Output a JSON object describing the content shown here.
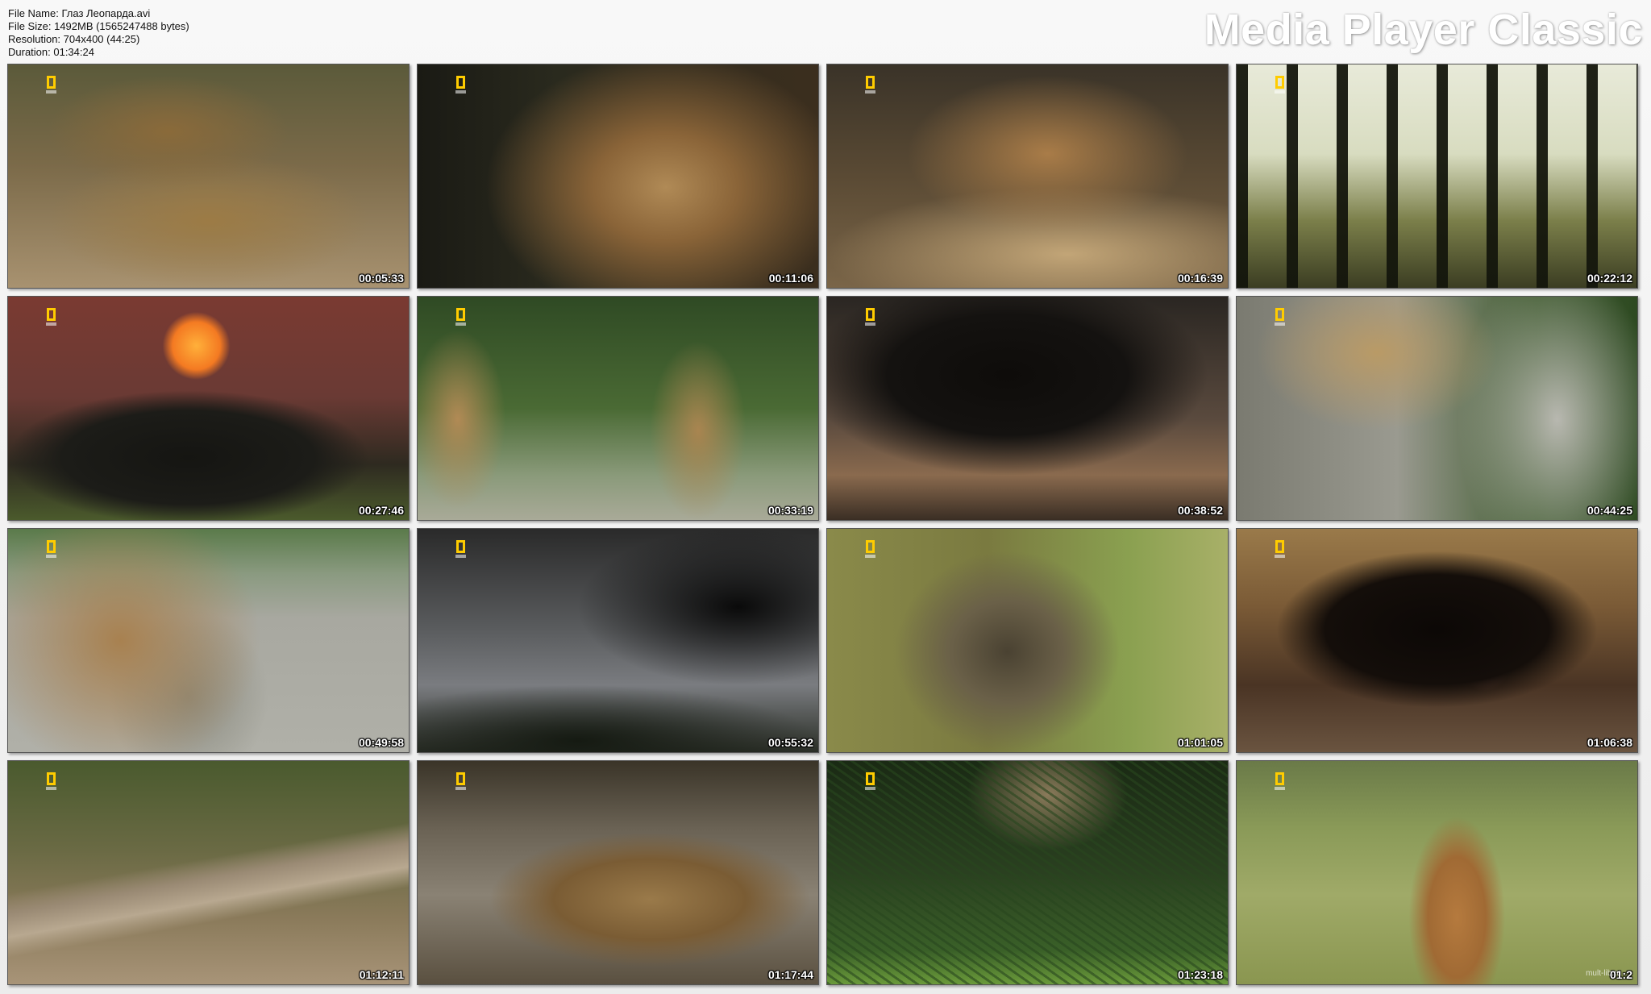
{
  "file_info": {
    "name": "File Name: Глаз Леопарда.avi",
    "size": "File Size: 1492MB (1565247488 bytes)",
    "resolution": "Resolution: 704x400 (44:25)",
    "duration": "Duration: 01:34:24"
  },
  "brand": "Media Player Classic",
  "thumbnails": [
    {
      "time": "00:05:33",
      "scene": "two leopards lying on dry ground"
    },
    {
      "time": "00:11:06",
      "scene": "close-up of leopard face"
    },
    {
      "time": "00:16:39",
      "scene": "leopard yawning on log"
    },
    {
      "time": "00:22:12",
      "scene": "silhouetted forest trees"
    },
    {
      "time": "00:27:46",
      "scene": "buffalo herd at sunset"
    },
    {
      "time": "00:33:19",
      "scene": "two leopards walking in grass"
    },
    {
      "time": "00:38:52",
      "scene": "silhouetted acacia tree"
    },
    {
      "time": "00:44:25",
      "scene": "leopard climbing dead tree"
    },
    {
      "time": "00:49:58",
      "scene": "leopard carrying prey"
    },
    {
      "time": "00:55:32",
      "scene": "tree silhouette under storm clouds"
    },
    {
      "time": "01:01:05",
      "scene": "baboon in grass"
    },
    {
      "time": "01:06:38",
      "scene": "leopard and baby baboon in log"
    },
    {
      "time": "01:12:11",
      "scene": "leopard behind fallen log"
    },
    {
      "time": "01:17:44",
      "scene": "leopard crouching on ground"
    },
    {
      "time": "01:23:18",
      "scene": "leopard among palm fronds"
    },
    {
      "time": "01:2",
      "scene": "impala in grassland"
    }
  ],
  "watermark_text": "mult-lib.ru"
}
